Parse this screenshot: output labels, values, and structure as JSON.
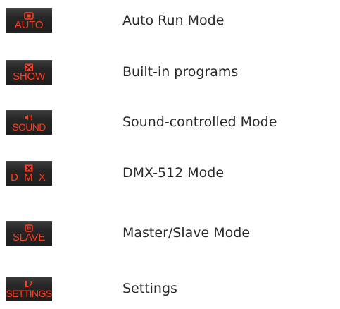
{
  "modes": [
    {
      "code": "AUTO",
      "label": "Auto Run Mode",
      "icon": "auto-icon"
    },
    {
      "code": "SHOW",
      "label": "Built-in programs",
      "icon": "show-icon"
    },
    {
      "code": "SOUND",
      "label": "Sound-controlled Mode",
      "icon": "sound-icon"
    },
    {
      "code": "D M X",
      "label": "DMX-512 Mode",
      "icon": "dmx-icon"
    },
    {
      "code": "SLAVE",
      "label": "Master/Slave Mode",
      "icon": "slave-icon"
    },
    {
      "code": "SETTINGS",
      "label": "Settings",
      "icon": "settings-icon"
    }
  ],
  "colors": {
    "badge_text": "#ff3b1f",
    "badge_bg": "#222222",
    "label_text": "#2a2a2a"
  }
}
